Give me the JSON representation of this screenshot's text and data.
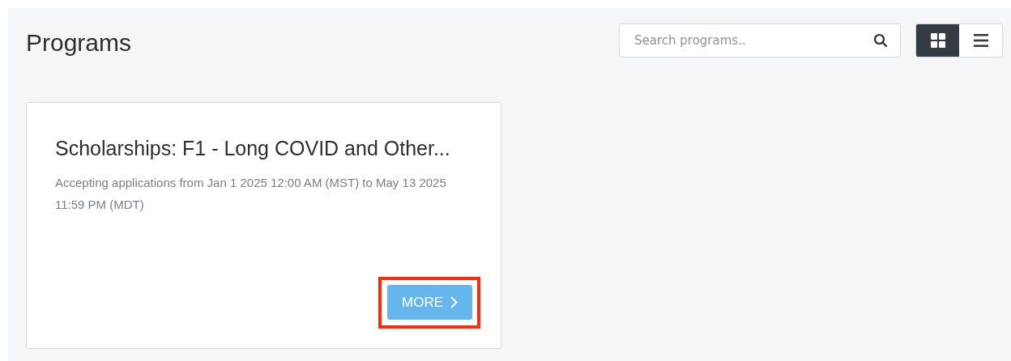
{
  "page": {
    "title": "Programs"
  },
  "search": {
    "placeholder": "Search programs.."
  },
  "view_toggle": [
    {
      "kind": "grid",
      "selected": true
    },
    {
      "kind": "list",
      "selected": false
    }
  ],
  "programs": [
    {
      "title": "Scholarships: F1 - Long COVID and Other...",
      "description": "Accepting applications from Jan 1 2025 12:00 AM (MST) to May 13 2025 11:59 PM (MDT)",
      "button": {
        "label": "MORE",
        "highlighted": true
      }
    }
  ]
}
